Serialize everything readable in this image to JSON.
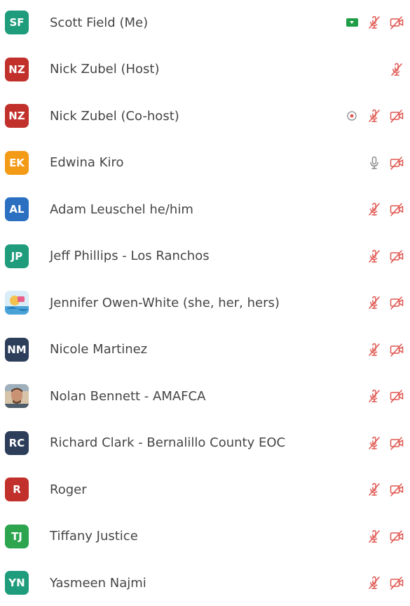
{
  "participants": [
    {
      "initials": "SF",
      "name": "Scott Field (Me)",
      "avatar_color": "#1f9c7c",
      "share": true,
      "mic": "muted",
      "video": "off"
    },
    {
      "initials": "NZ",
      "name": "Nick Zubel (Host)",
      "avatar_color": "#c1302b",
      "share": false,
      "mic": "muted",
      "video": "none"
    },
    {
      "initials": "NZ",
      "name": "Nick Zubel (Co-host)",
      "avatar_color": "#c1302b",
      "share": false,
      "record": true,
      "mic": "muted",
      "video": "off"
    },
    {
      "initials": "EK",
      "name": "Edwina Kiro",
      "avatar_color": "#f39a16",
      "share": false,
      "mic": "on",
      "video": "off"
    },
    {
      "initials": "AL",
      "name": "Adam Leuschel he/him",
      "avatar_color": "#2a6fc0",
      "share": false,
      "mic": "muted",
      "video": "off"
    },
    {
      "initials": "JP",
      "name": "Jeff Phillips - Los Ranchos",
      "avatar_color": "#1f9c7c",
      "share": false,
      "mic": "muted",
      "video": "off"
    },
    {
      "initials": "",
      "name": "Jennifer Owen-White (she, her, hers)",
      "avatar_color": "#e8eef5",
      "photo": "cartoon-avatar",
      "share": false,
      "mic": "muted",
      "video": "off"
    },
    {
      "initials": "NM",
      "name": "Nicole Martinez",
      "avatar_color": "#2c3e5a",
      "share": false,
      "mic": "muted",
      "video": "off"
    },
    {
      "initials": "",
      "name": "Nolan Bennett - AMAFCA",
      "avatar_color": "#c9a585",
      "photo": "person-photo",
      "share": false,
      "mic": "muted",
      "video": "off"
    },
    {
      "initials": "RC",
      "name": "Richard Clark - Bernalillo County EOC",
      "avatar_color": "#2c3e5a",
      "share": false,
      "mic": "muted",
      "video": "off"
    },
    {
      "initials": "R",
      "name": "Roger",
      "avatar_color": "#c1302b",
      "share": false,
      "mic": "muted",
      "video": "off"
    },
    {
      "initials": "TJ",
      "name": "Tiffany Justice",
      "avatar_color": "#2da54f",
      "share": false,
      "mic": "muted",
      "video": "off"
    },
    {
      "initials": "YN",
      "name": "Yasmeen Najmi",
      "avatar_color": "#1f9c7c",
      "share": false,
      "mic": "muted",
      "video": "off"
    }
  ],
  "colors": {
    "muted_red": "#e0554f",
    "share_green": "#1f9d47",
    "text": "#454545",
    "icon_gray": "#8a8a8a"
  }
}
